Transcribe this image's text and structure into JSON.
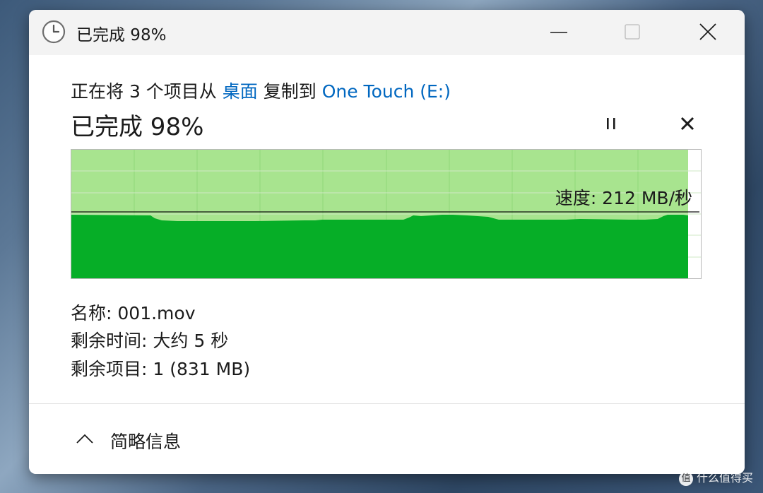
{
  "window": {
    "title": "已完成 98%"
  },
  "header": {
    "prefix": "正在将 3 个项目从",
    "source": "桌面",
    "middle": "复制到",
    "destination": "One Touch (E:)",
    "progress_text": "已完成 98%"
  },
  "graph": {
    "speed_text": "速度: 212 MB/秒",
    "progress_fraction": 0.98,
    "speed_mb_per_s": 212
  },
  "details": {
    "name_label": "名称:",
    "name_value": "001.mov",
    "time_label": "剩余时间:",
    "time_value": "大约 5 秒",
    "items_label": "剩余项目:",
    "items_value": "1 (831 MB)"
  },
  "footer": {
    "toggle_label": "简略信息"
  },
  "watermark": {
    "text": "什么值得买"
  },
  "colors": {
    "fill_done": "#a8e48f",
    "fill_speed": "#06ae27",
    "link": "#0067c0"
  },
  "icons": {
    "title": "clock-icon",
    "minimize": "minimize-icon",
    "maximize": "maximize-icon",
    "close": "close-icon",
    "pause": "pause-icon",
    "cancel": "cancel-icon",
    "toggle": "chevron-up-icon"
  }
}
